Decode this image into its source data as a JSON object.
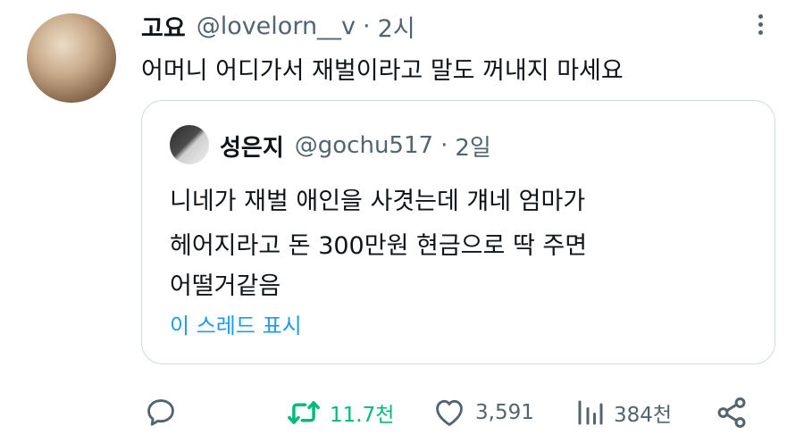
{
  "tweet": {
    "display_name": "고요",
    "handle": "@lovelorn__v",
    "separator": "·",
    "time": "2시",
    "text": "어머니 어디가서 재벌이라고 말도 꺼내지 마세요",
    "more_icon": "more-options-icon"
  },
  "quoted": {
    "display_name": "성은지",
    "handle": "@gochu517",
    "separator": "·",
    "time": "2일",
    "lines": [
      "니네가 재벌 애인을 사겻는데 걔네 엄마가",
      "헤어지라고 돈 300만원 현금으로 딱 주면",
      "어떨거같음"
    ],
    "show_thread": "이 스레드 표시"
  },
  "actions": {
    "reply": {
      "icon": "reply-icon",
      "count": ""
    },
    "retweet": {
      "icon": "retweet-icon",
      "count": "11.7천",
      "color": "#00ba7c"
    },
    "like": {
      "icon": "heart-icon",
      "count": "3,591"
    },
    "views": {
      "icon": "views-icon",
      "count": "384천"
    },
    "share": {
      "icon": "share-icon",
      "count": ""
    }
  },
  "colors": {
    "text": "#0f1419",
    "secondary": "#536471",
    "accent": "#1d9bf0",
    "retweet_active": "#00ba7c",
    "border": "#cfd9de"
  }
}
